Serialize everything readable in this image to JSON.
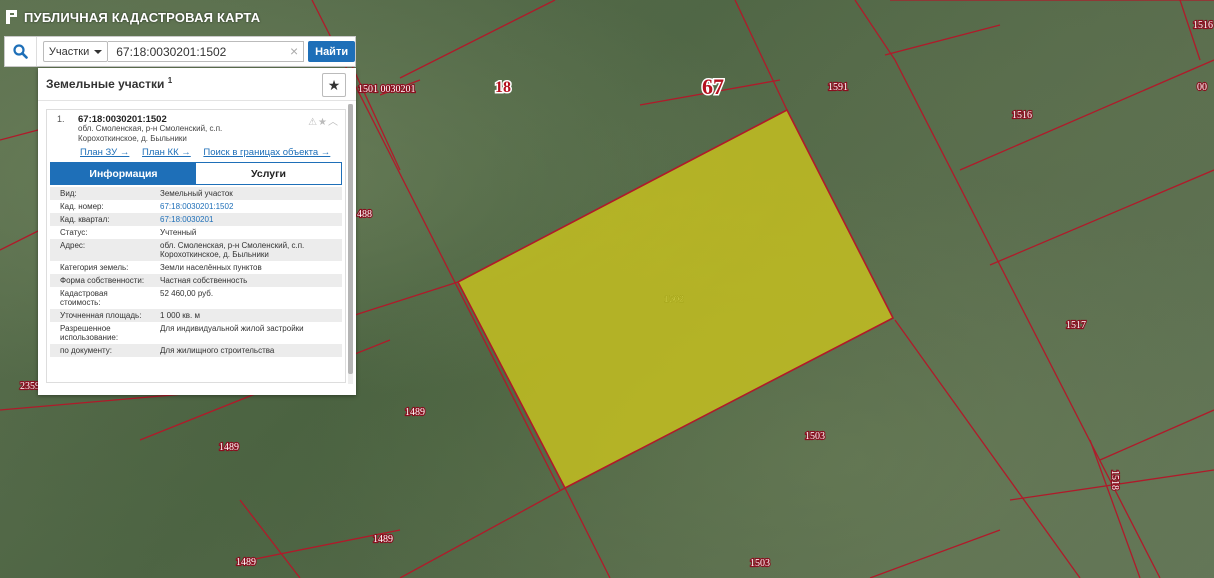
{
  "app": {
    "title": "ПУБЛИЧНАЯ КАДАСТРОВАЯ КАРТА",
    "logo_icon": "pkk-logo-icon"
  },
  "search": {
    "type_label": "Участки",
    "query": "67:18:0030201:1502",
    "find_label": "Найти"
  },
  "panel": {
    "title": "Земельные участки",
    "count": "1",
    "result": {
      "index": "1.",
      "cad_number": "67:18:0030201:1502",
      "address": "обл. Смоленская, р-н Смоленский, с.п. Корохоткинское, д. Быльники",
      "links": [
        "План ЗУ →",
        "План КК →",
        "Поиск в границах объекта →"
      ],
      "tabs": [
        "Информация",
        "Услуги"
      ],
      "active_tab": "Информация",
      "info": [
        {
          "key": "Вид:",
          "value": "Земельный участок"
        },
        {
          "key": "Кад. номер:",
          "value": "67:18:0030201:1502",
          "link": true
        },
        {
          "key": "Кад. квартал:",
          "value": "67:18:0030201",
          "link": true
        },
        {
          "key": "Статус:",
          "value": "Учтенный"
        },
        {
          "key": "Адрес:",
          "value": "обл. Смоленская, р-н Смоленский, с.п. Корохоткинское, д. Быльники"
        },
        {
          "key": "Категория земель:",
          "value": "Земли населённых пунктов"
        },
        {
          "key": "Форма собственности:",
          "value": "Частная собственность"
        },
        {
          "key": "Кадастровая стоимость:",
          "value": "52 460,00 руб."
        },
        {
          "key": "Уточненная площадь:",
          "value": "1 000 кв. м"
        },
        {
          "key": "Разрешенное использование:",
          "value": "Для индивидуальной жилой застройки"
        },
        {
          "key": "по документу:",
          "value": "Для жилищного строительства"
        }
      ]
    }
  },
  "map": {
    "labels": {
      "l_0030201": "1501 0030201",
      "l_18": "18",
      "l_67": "67",
      "l_1591": "1591",
      "l_1516_top": "1516",
      "l_00_right": "00",
      "l_1516": "1516",
      "l_488": "488",
      "l_1502": "1502",
      "l_1517": "1517",
      "l_2359": "2359",
      "l_1489_a": "1489",
      "l_1489_b": "1489",
      "l_1503_a": "1503",
      "l_1518": "1518",
      "l_1489_c": "1489",
      "l_1489_d": "1489",
      "l_1503_b": "1503"
    },
    "selected_parcel_color": "#c8c21e",
    "boundary_color": "#b01a2a"
  }
}
